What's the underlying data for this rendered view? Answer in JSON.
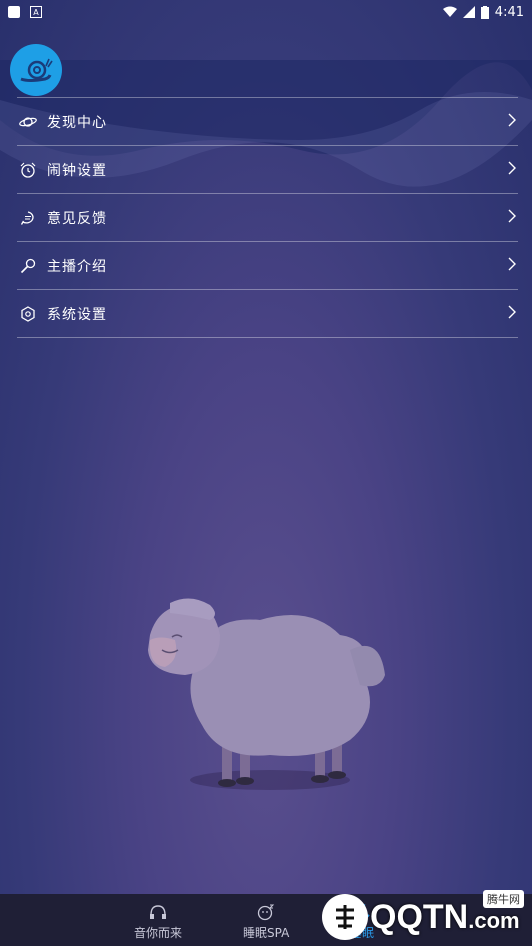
{
  "status_bar": {
    "time": "4:41"
  },
  "menu": {
    "items": [
      {
        "label": "发现中心",
        "icon": "planet-icon"
      },
      {
        "label": "闹钟设置",
        "icon": "alarm-clock-icon"
      },
      {
        "label": "意见反馈",
        "icon": "chat-bubble-icon"
      },
      {
        "label": "主播介绍",
        "icon": "microphone-icon"
      },
      {
        "label": "系统设置",
        "icon": "settings-gear-icon"
      }
    ]
  },
  "tabs": [
    {
      "label": "音你而来",
      "icon": "headphones-icon"
    },
    {
      "label": "睡眠SPA",
      "icon": "sleep-face-icon"
    },
    {
      "label": "睡眠",
      "icon": "sleep-icon"
    }
  ],
  "watermark": {
    "logo_text": "QQTN",
    "domain_suffix": ".com",
    "badge": "腾牛网"
  },
  "colors": {
    "accent": "#1e9fe6",
    "background": "#363a78",
    "tab_bar": "#1f1f36"
  }
}
